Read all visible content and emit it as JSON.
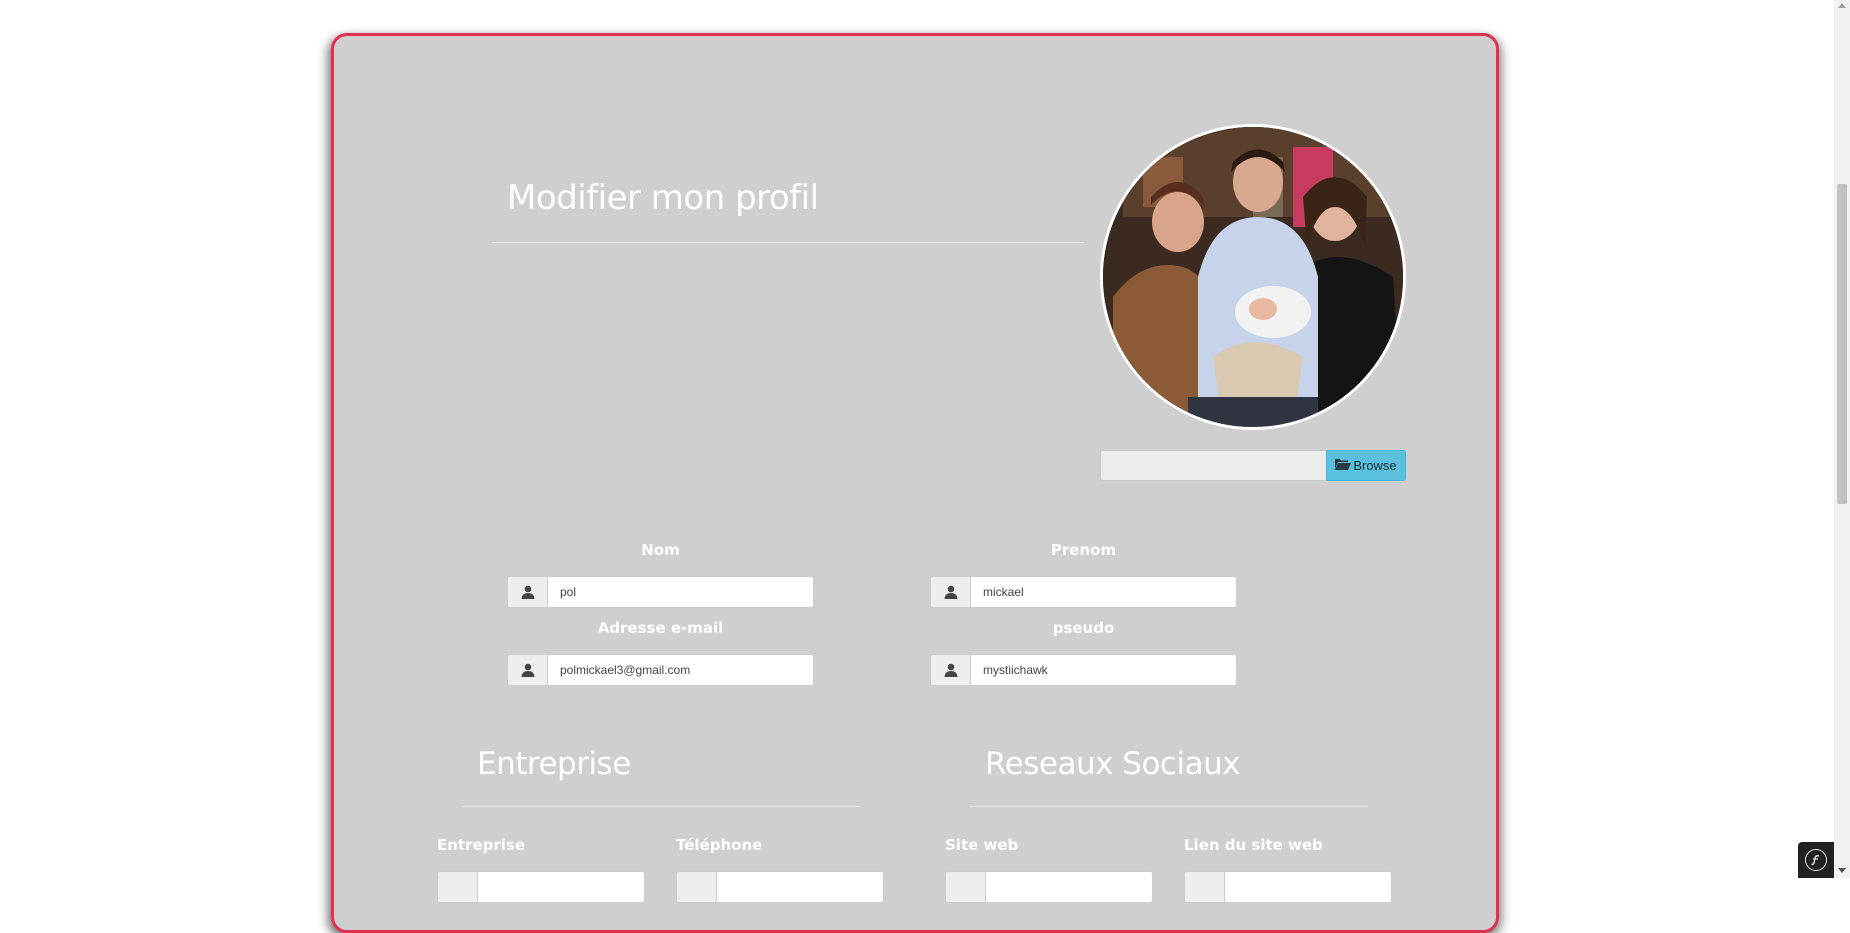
{
  "profile": {
    "title": "Modifier mon profil",
    "browse_label": "Browse",
    "file_value": ""
  },
  "fields": {
    "nom_label": "Nom",
    "nom_value": "pol",
    "prenom_label": "Prenom",
    "prenom_value": "mickael",
    "email_label": "Adresse e-mail",
    "email_value": "polmickael3@gmail.com",
    "pseudo_label": "pseudo",
    "pseudo_value": "mystiichawk"
  },
  "entreprise": {
    "title": "Entreprise",
    "entreprise_label": "Entreprise",
    "telephone_label": "Téléphone"
  },
  "reseaux": {
    "title": "Reseaux Sociaux",
    "site_web_label": "Site web",
    "lien_label": "Lien du site web"
  },
  "colors": {
    "card_bg": "#cfcfcf",
    "card_border": "#e0324f",
    "browse_button": "#5bc0de"
  },
  "icons": {
    "field_icon": "user-icon",
    "browse_icon": "folder-open-icon",
    "toolbar_icon": "symfony-icon"
  }
}
